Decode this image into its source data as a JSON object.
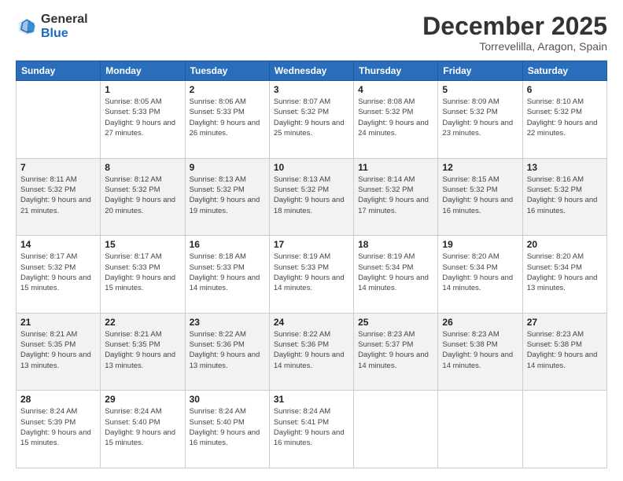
{
  "logo": {
    "line1": "General",
    "line2": "Blue"
  },
  "header": {
    "month_year": "December 2025",
    "location": "Torrevelilla, Aragon, Spain"
  },
  "days_of_week": [
    "Sunday",
    "Monday",
    "Tuesday",
    "Wednesday",
    "Thursday",
    "Friday",
    "Saturday"
  ],
  "weeks": [
    [
      {
        "day": "",
        "sunrise": "",
        "sunset": "",
        "daylight": ""
      },
      {
        "day": "1",
        "sunrise": "Sunrise: 8:05 AM",
        "sunset": "Sunset: 5:33 PM",
        "daylight": "Daylight: 9 hours and 27 minutes."
      },
      {
        "day": "2",
        "sunrise": "Sunrise: 8:06 AM",
        "sunset": "Sunset: 5:33 PM",
        "daylight": "Daylight: 9 hours and 26 minutes."
      },
      {
        "day": "3",
        "sunrise": "Sunrise: 8:07 AM",
        "sunset": "Sunset: 5:32 PM",
        "daylight": "Daylight: 9 hours and 25 minutes."
      },
      {
        "day": "4",
        "sunrise": "Sunrise: 8:08 AM",
        "sunset": "Sunset: 5:32 PM",
        "daylight": "Daylight: 9 hours and 24 minutes."
      },
      {
        "day": "5",
        "sunrise": "Sunrise: 8:09 AM",
        "sunset": "Sunset: 5:32 PM",
        "daylight": "Daylight: 9 hours and 23 minutes."
      },
      {
        "day": "6",
        "sunrise": "Sunrise: 8:10 AM",
        "sunset": "Sunset: 5:32 PM",
        "daylight": "Daylight: 9 hours and 22 minutes."
      }
    ],
    [
      {
        "day": "7",
        "sunrise": "Sunrise: 8:11 AM",
        "sunset": "Sunset: 5:32 PM",
        "daylight": "Daylight: 9 hours and 21 minutes."
      },
      {
        "day": "8",
        "sunrise": "Sunrise: 8:12 AM",
        "sunset": "Sunset: 5:32 PM",
        "daylight": "Daylight: 9 hours and 20 minutes."
      },
      {
        "day": "9",
        "sunrise": "Sunrise: 8:13 AM",
        "sunset": "Sunset: 5:32 PM",
        "daylight": "Daylight: 9 hours and 19 minutes."
      },
      {
        "day": "10",
        "sunrise": "Sunrise: 8:13 AM",
        "sunset": "Sunset: 5:32 PM",
        "daylight": "Daylight: 9 hours and 18 minutes."
      },
      {
        "day": "11",
        "sunrise": "Sunrise: 8:14 AM",
        "sunset": "Sunset: 5:32 PM",
        "daylight": "Daylight: 9 hours and 17 minutes."
      },
      {
        "day": "12",
        "sunrise": "Sunrise: 8:15 AM",
        "sunset": "Sunset: 5:32 PM",
        "daylight": "Daylight: 9 hours and 16 minutes."
      },
      {
        "day": "13",
        "sunrise": "Sunrise: 8:16 AM",
        "sunset": "Sunset: 5:32 PM",
        "daylight": "Daylight: 9 hours and 16 minutes."
      }
    ],
    [
      {
        "day": "14",
        "sunrise": "Sunrise: 8:17 AM",
        "sunset": "Sunset: 5:32 PM",
        "daylight": "Daylight: 9 hours and 15 minutes."
      },
      {
        "day": "15",
        "sunrise": "Sunrise: 8:17 AM",
        "sunset": "Sunset: 5:33 PM",
        "daylight": "Daylight: 9 hours and 15 minutes."
      },
      {
        "day": "16",
        "sunrise": "Sunrise: 8:18 AM",
        "sunset": "Sunset: 5:33 PM",
        "daylight": "Daylight: 9 hours and 14 minutes."
      },
      {
        "day": "17",
        "sunrise": "Sunrise: 8:19 AM",
        "sunset": "Sunset: 5:33 PM",
        "daylight": "Daylight: 9 hours and 14 minutes."
      },
      {
        "day": "18",
        "sunrise": "Sunrise: 8:19 AM",
        "sunset": "Sunset: 5:34 PM",
        "daylight": "Daylight: 9 hours and 14 minutes."
      },
      {
        "day": "19",
        "sunrise": "Sunrise: 8:20 AM",
        "sunset": "Sunset: 5:34 PM",
        "daylight": "Daylight: 9 hours and 14 minutes."
      },
      {
        "day": "20",
        "sunrise": "Sunrise: 8:20 AM",
        "sunset": "Sunset: 5:34 PM",
        "daylight": "Daylight: 9 hours and 13 minutes."
      }
    ],
    [
      {
        "day": "21",
        "sunrise": "Sunrise: 8:21 AM",
        "sunset": "Sunset: 5:35 PM",
        "daylight": "Daylight: 9 hours and 13 minutes."
      },
      {
        "day": "22",
        "sunrise": "Sunrise: 8:21 AM",
        "sunset": "Sunset: 5:35 PM",
        "daylight": "Daylight: 9 hours and 13 minutes."
      },
      {
        "day": "23",
        "sunrise": "Sunrise: 8:22 AM",
        "sunset": "Sunset: 5:36 PM",
        "daylight": "Daylight: 9 hours and 13 minutes."
      },
      {
        "day": "24",
        "sunrise": "Sunrise: 8:22 AM",
        "sunset": "Sunset: 5:36 PM",
        "daylight": "Daylight: 9 hours and 14 minutes."
      },
      {
        "day": "25",
        "sunrise": "Sunrise: 8:23 AM",
        "sunset": "Sunset: 5:37 PM",
        "daylight": "Daylight: 9 hours and 14 minutes."
      },
      {
        "day": "26",
        "sunrise": "Sunrise: 8:23 AM",
        "sunset": "Sunset: 5:38 PM",
        "daylight": "Daylight: 9 hours and 14 minutes."
      },
      {
        "day": "27",
        "sunrise": "Sunrise: 8:23 AM",
        "sunset": "Sunset: 5:38 PM",
        "daylight": "Daylight: 9 hours and 14 minutes."
      }
    ],
    [
      {
        "day": "28",
        "sunrise": "Sunrise: 8:24 AM",
        "sunset": "Sunset: 5:39 PM",
        "daylight": "Daylight: 9 hours and 15 minutes."
      },
      {
        "day": "29",
        "sunrise": "Sunrise: 8:24 AM",
        "sunset": "Sunset: 5:40 PM",
        "daylight": "Daylight: 9 hours and 15 minutes."
      },
      {
        "day": "30",
        "sunrise": "Sunrise: 8:24 AM",
        "sunset": "Sunset: 5:40 PM",
        "daylight": "Daylight: 9 hours and 16 minutes."
      },
      {
        "day": "31",
        "sunrise": "Sunrise: 8:24 AM",
        "sunset": "Sunset: 5:41 PM",
        "daylight": "Daylight: 9 hours and 16 minutes."
      },
      {
        "day": "",
        "sunrise": "",
        "sunset": "",
        "daylight": ""
      },
      {
        "day": "",
        "sunrise": "",
        "sunset": "",
        "daylight": ""
      },
      {
        "day": "",
        "sunrise": "",
        "sunset": "",
        "daylight": ""
      }
    ]
  ]
}
